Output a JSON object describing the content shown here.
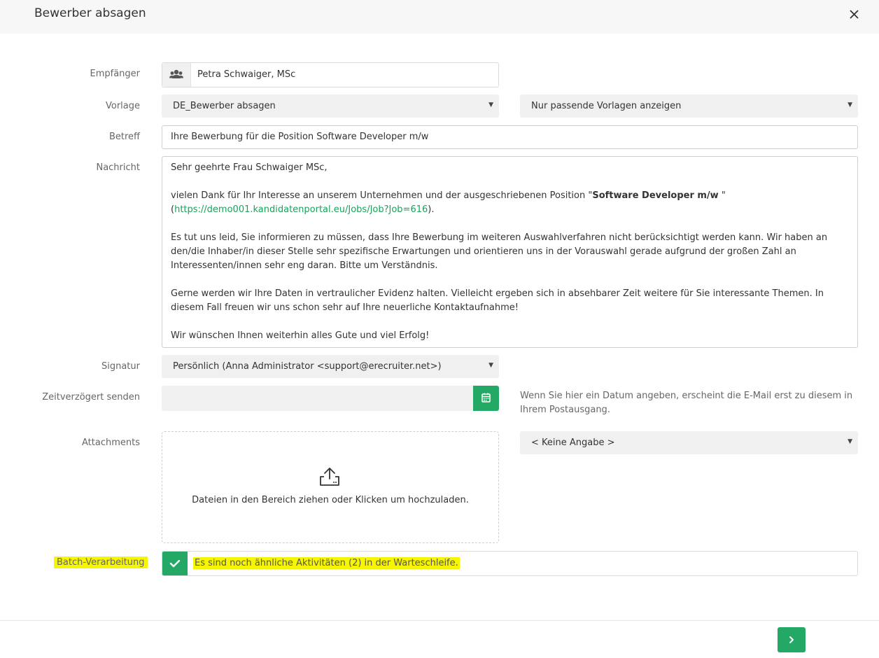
{
  "dialog": {
    "title": "Bewerber absagen"
  },
  "labels": {
    "recipient": "Empfänger",
    "template": "Vorlage",
    "subject": "Betreff",
    "message": "Nachricht",
    "signature": "Signatur",
    "delayed": "Zeitverzögert senden",
    "attachments": "Attachments",
    "batch": "Batch-Verarbeitung"
  },
  "recipient": {
    "value": "Petra Schwaiger, MSc"
  },
  "template": {
    "selected": "DE_Bewerber absagen",
    "filter_selected": "Nur passende Vorlagen anzeigen"
  },
  "subject": {
    "value": "Ihre Bewerbung für die Position Software Developer m/w"
  },
  "message": {
    "greeting": "Sehr geehrte Frau Schwaiger MSc,",
    "p1_a": "vielen Dank für Ihr Interesse an unserem Unternehmen und der ausgeschriebenen Position \"",
    "p1_bold": "Software Developer m/w",
    "p1_b": " \"",
    "p1_paren_open": "(",
    "p1_link": "https://demo001.kandidatenportal.eu/Jobs/Job?Job=616",
    "p1_paren_close": ").",
    "p2": "Es tut uns leid, Sie informieren zu müssen, dass Ihre Bewerbung im weiteren Auswahlverfahren nicht berücksichtigt werden kann. Wir haben an den/die Inhaber/in dieser Stelle sehr spezifische Erwartungen und orientieren uns in der Vorauswahl gerade aufgrund der großen Zahl an Interessenten/innen sehr eng daran. Bitte um Verständnis.",
    "p3": "Gerne werden wir Ihre Daten in vertraulicher Evidenz halten. Vielleicht ergeben sich in absehbarer Zeit weitere für Sie interessante Themen. In diesem Fall freuen wir uns schon sehr auf Ihre neuerliche Kontaktaufnahme!",
    "p4": "Wir wünschen Ihnen weiterhin alles Gute und viel Erfolg!"
  },
  "signature": {
    "selected": "Persönlich (Anna Administrator <support@erecruiter.net>)"
  },
  "delayed": {
    "value": "",
    "hint": "Wenn Sie hier ein Datum angeben, erscheint die E-Mail erst zu diesem in Ihrem Postausgang."
  },
  "attachments": {
    "dropzone_text": "Dateien in den Bereich ziehen oder Klicken um hochzuladen.",
    "select_selected": "< Keine Angabe >"
  },
  "batch": {
    "checked": true,
    "text": "Es sind noch ähnliche Aktivitäten (2) in der Warteschleife."
  },
  "colors": {
    "accent": "#23a866",
    "highlight": "#f6f600",
    "link": "#1aa35a"
  },
  "icons": {
    "close": "close-icon",
    "recipient": "users-icon",
    "calendar": "calendar-icon",
    "upload": "upload-icon",
    "check": "check-icon",
    "next": "chevron-right-icon"
  }
}
